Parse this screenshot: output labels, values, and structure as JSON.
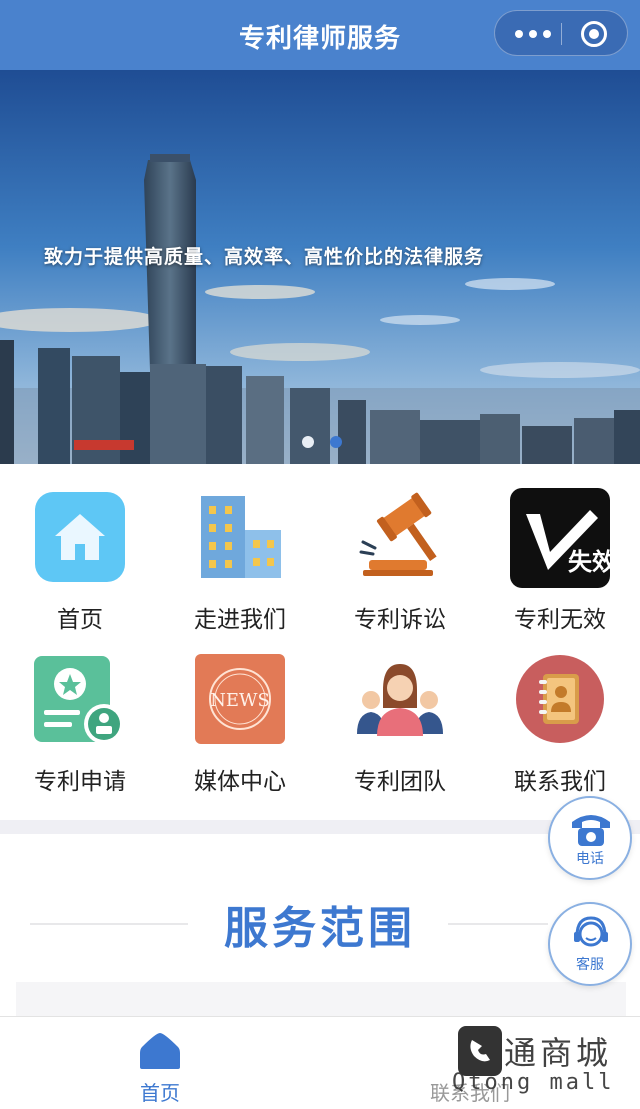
{
  "header": {
    "title": "专利律师服务",
    "menu_icon": "more-dots-icon",
    "close_icon": "target-circle-icon"
  },
  "banner": {
    "caption": "致力于提供高质量、高效率、高性价比的法律服务",
    "slide_count": 2,
    "active_slide": 2
  },
  "nav": [
    {
      "label": "首页",
      "icon": "home-icon"
    },
    {
      "label": "走进我们",
      "icon": "building-icon"
    },
    {
      "label": "专利诉讼",
      "icon": "gavel-icon"
    },
    {
      "label": "专利无效",
      "icon": "invalid-v-icon",
      "icon_text": "失效"
    },
    {
      "label": "专利申请",
      "icon": "certificate-icon"
    },
    {
      "label": "媒体中心",
      "icon": "news-icon",
      "icon_text": "NEWS"
    },
    {
      "label": "专利团队",
      "icon": "team-icon"
    },
    {
      "label": "联系我们",
      "icon": "contact-book-icon"
    }
  ],
  "section": {
    "title": "服务范围"
  },
  "floating": {
    "phone_label": "电话",
    "service_label": "客服"
  },
  "tabbar": {
    "home_label": "首页",
    "contact_label": "联系我们"
  },
  "watermark": {
    "text": "通商城",
    "sub": "Qtong mall"
  },
  "colors": {
    "brand": "#4a82cd",
    "accent": "#3d78d0"
  }
}
